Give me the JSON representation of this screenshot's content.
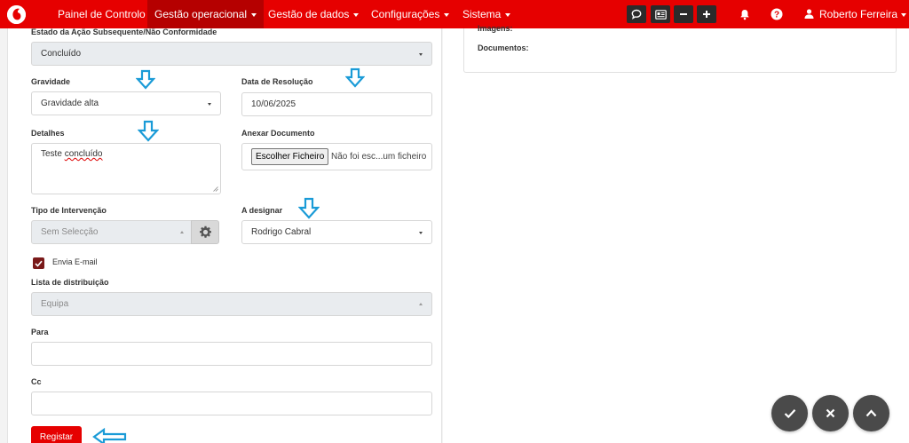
{
  "navbar": {
    "items": [
      {
        "label": "Painel de Controlo",
        "has_caret": false
      },
      {
        "label": "Gestão operacional",
        "has_caret": true
      },
      {
        "label": "Gestão de dados",
        "has_caret": true
      },
      {
        "label": "Configurações",
        "has_caret": true
      },
      {
        "label": "Sistema",
        "has_caret": true
      }
    ],
    "user_name": "Roberto Ferreira",
    "brand_color": "#e60000"
  },
  "form": {
    "estado_label": "Estado da Ação Subsequente/Não Conformidade",
    "estado_value": "Concluído",
    "gravidade_label": "Gravidade",
    "gravidade_value": "Gravidade alta",
    "data_resolucao_label": "Data de Resolução",
    "data_resolucao_value": "10/06/2025",
    "detalhes_label": "Detalhes",
    "detalhes_value_plain": "Teste ",
    "detalhes_value_spell": "concluído",
    "anexar_label": "Anexar Documento",
    "file_button_label": "Escolher Ficheiro",
    "file_status": "Não foi esc...um ficheiro",
    "tipo_intervencao_label": "Tipo de Intervenção",
    "tipo_intervencao_placeholder": "Sem Selecção",
    "a_designar_label": "A designar",
    "a_designar_value": "Rodrigo Cabral",
    "envia_email_label": "Envia E-mail",
    "envia_email_checked": true,
    "lista_distribuicao_label": "Lista de distribuição",
    "lista_distribuicao_placeholder": "Equipa",
    "para_label": "Para",
    "para_value": "",
    "cc_label": "Cc",
    "cc_value": "",
    "register_label": "Registar"
  },
  "right_panel": {
    "imagens_label": "Imagens:",
    "documentos_label": "Documentos:"
  },
  "icons": {
    "nav_buttons": [
      "chat-icon",
      "id-card-icon",
      "minus-icon",
      "plus-icon"
    ],
    "nav_icons": [
      "bell-icon",
      "help-icon",
      "user-icon"
    ],
    "fabs": [
      "check-icon",
      "close-icon",
      "chevron-up-icon"
    ]
  },
  "colors": {
    "annotation_arrow": "#1a9bd7",
    "checkbox": "#7a1a1a",
    "fab": "#4a4a4a"
  }
}
